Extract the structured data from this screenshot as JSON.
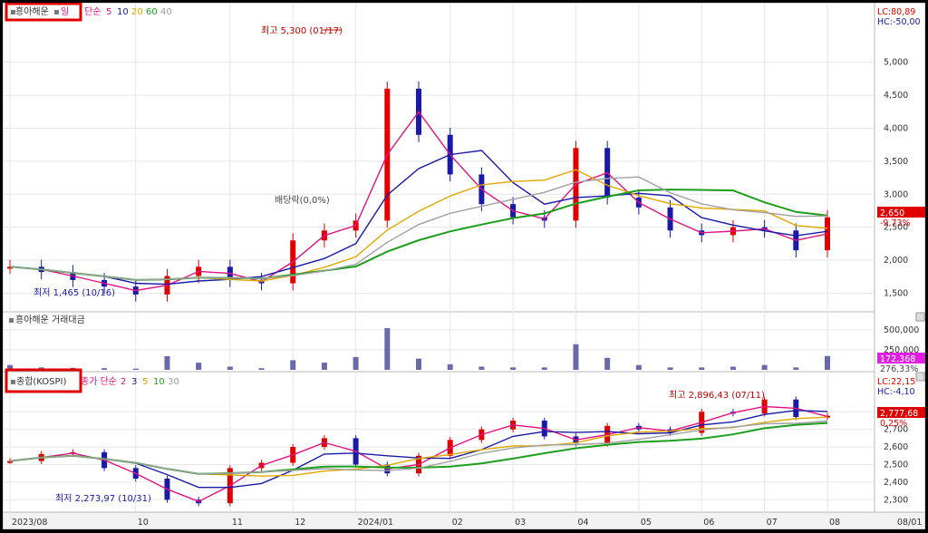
{
  "header": {
    "stock_name": "흥아해운",
    "period": "일",
    "ma_label": "단순",
    "ma_periods": [
      "5",
      "10",
      "20",
      "60",
      "40"
    ],
    "ma_colors": [
      "#e0147f",
      "#1a1aa8",
      "#e0a800",
      "#1e9e1e",
      "#a0a0a0"
    ],
    "lc": "LC:80,89",
    "hc": "HC:-50,00"
  },
  "volume_panel": {
    "title": "흥아해운 거래대금"
  },
  "index_header": {
    "index_name": "종합(KOSPI)",
    "ma_label": "종가 단순",
    "ma_periods": [
      "2",
      "3",
      "5",
      "10",
      "30"
    ],
    "ma_colors": [
      "#e0147f",
      "#1a1aa8",
      "#e0a800",
      "#1e9e1e",
      "#a0a0a0"
    ],
    "lc": "LC:22,15",
    "hc": "HC:-4,10"
  },
  "annotations": {
    "price_high": "최고 5,300 (01/17)",
    "price_low": "최저 1,465 (10/16)",
    "ex_dividend": "배당락(0,0%)",
    "index_high": "최고 2,896,43 (07/11)",
    "index_low": "최저 2,273,97 (10/31)"
  },
  "badges": {
    "price_last": "2,650",
    "price_change": "-9,73%",
    "volume_last": "172,368",
    "volume_change": "276,33%",
    "index_last": "2,777,68",
    "index_change": "0,25%"
  },
  "chart_data": [
    {
      "type": "candlestick",
      "title": "흥아해운",
      "x": [
        "2023/08",
        "2023/08",
        "2023/09",
        "2023/09",
        "2023/10",
        "2023/10",
        "2023/10",
        "2023/11",
        "2023/11",
        "2023/12",
        "2023/12",
        "2024/01",
        "2024/01",
        "2024/01",
        "2024/02",
        "2024/02",
        "2024/03",
        "2024/03",
        "2024/04",
        "2024/04",
        "2024/05",
        "2024/05",
        "2024/06",
        "2024/06",
        "2024/07",
        "2024/07",
        "2024/08"
      ],
      "x_ticks": [
        "2023/08",
        "10",
        "11",
        "12",
        "2024/01",
        "02",
        "03",
        "04",
        "05",
        "06",
        "07",
        "08",
        "08/01"
      ],
      "close": [
        1900,
        1820,
        1700,
        1600,
        1480,
        1760,
        1900,
        1700,
        1650,
        2300,
        2450,
        2600,
        4600,
        3900,
        3300,
        2850,
        2650,
        2600,
        3700,
        2950,
        2800,
        2450,
        2380,
        2500,
        2450,
        2150,
        2650
      ],
      "y_ticks": [
        1500,
        2000,
        2500,
        3000,
        3500,
        4000,
        4500,
        5000
      ],
      "ylim": [
        1300,
        5600
      ]
    },
    {
      "type": "bar",
      "title": "흥아해운 거래대금",
      "values": [
        60,
        30,
        25,
        20,
        15,
        170,
        90,
        40,
        20,
        120,
        90,
        160,
        520,
        140,
        70,
        40,
        30,
        30,
        320,
        150,
        60,
        30,
        30,
        40,
        60,
        30,
        172
      ],
      "y_ticks": [
        250000,
        500000
      ],
      "ylim": [
        0,
        600000
      ]
    },
    {
      "type": "candlestick",
      "title": "종합(KOSPI)",
      "x": [
        "2023/08",
        "2023/08",
        "2023/09",
        "2023/09",
        "2023/10",
        "2023/10",
        "2023/10",
        "2023/11",
        "2023/11",
        "2023/12",
        "2023/12",
        "2024/01",
        "2024/01",
        "2024/01",
        "2024/02",
        "2024/02",
        "2024/03",
        "2024/03",
        "2024/04",
        "2024/04",
        "2024/05",
        "2024/05",
        "2024/06",
        "2024/06",
        "2024/07",
        "2024/07",
        "2024/08"
      ],
      "x_ticks": [
        "2023/08",
        "10",
        "11",
        "12",
        "2024/01",
        "02",
        "03",
        "04",
        "05",
        "06",
        "07",
        "08",
        "08/01"
      ],
      "close": [
        2520,
        2560,
        2570,
        2480,
        2420,
        2300,
        2280,
        2480,
        2510,
        2600,
        2650,
        2500,
        2450,
        2550,
        2640,
        2700,
        2750,
        2660,
        2620,
        2720,
        2700,
        2680,
        2800,
        2790,
        2870,
        2770,
        2777.68
      ],
      "y_ticks": [
        2300,
        2400,
        2500,
        2600,
        2700,
        2800
      ],
      "ylim": [
        2250,
        2920
      ]
    }
  ]
}
